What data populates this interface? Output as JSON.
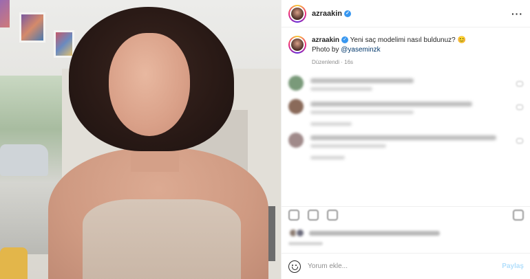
{
  "post": {
    "username": "azraakin",
    "caption_username": "azraakin",
    "caption_text": "Yeni saç modelimi nasıl buldunuz? 😊",
    "photo_credit_prefix": "Photo by ",
    "photo_credit_mention": "@yaseminzk",
    "edited_meta": "Düzenlendi · 16s"
  },
  "comment_box": {
    "placeholder": "Yorum ekle...",
    "post_label": "Paylaş"
  },
  "colors": {
    "verified": "#3897f0",
    "mention": "#00376b",
    "post_button_disabled": "#b2dffc"
  }
}
